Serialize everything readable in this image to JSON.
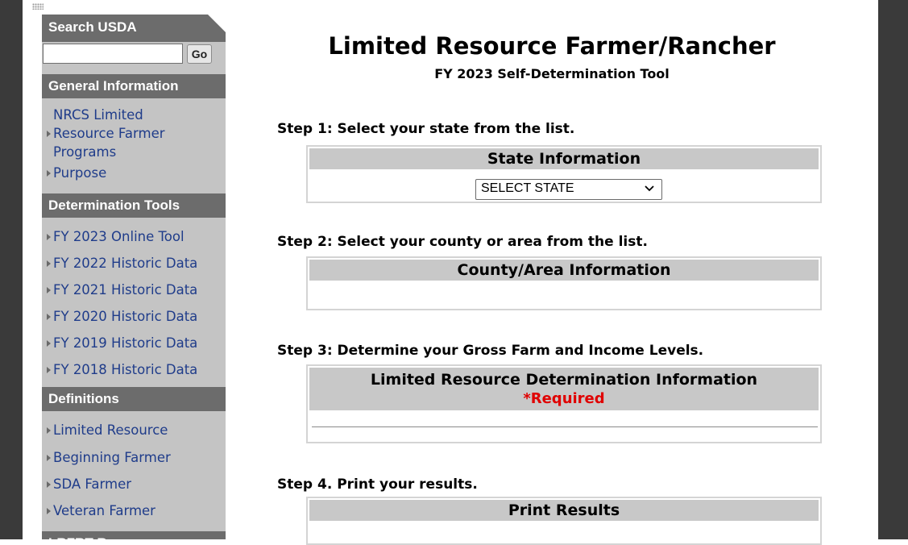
{
  "sidebar": {
    "search_title": "Search USDA",
    "go_label": "Go",
    "sections": {
      "general": "General Information",
      "tools": "Determination Tools",
      "definitions": "Definitions",
      "resources": "LRFRT Resources"
    },
    "general_items": [
      "NRCS Limited\nResource Farmer\nPrograms",
      "Purpose"
    ],
    "tool_items": [
      "FY 2023 Online Tool",
      "FY 2022 Historic Data",
      "FY 2021 Historic Data",
      "FY 2020 Historic Data",
      "FY 2019 Historic Data",
      "FY 2018 Historic Data"
    ],
    "definition_items": [
      "Limited Resource",
      "Beginning Farmer",
      "SDA Farmer",
      "Veteran Farmer"
    ]
  },
  "main": {
    "title": "Limited Resource Farmer/Rancher",
    "subtitle": "FY 2023 Self-Determination Tool",
    "step1": "Step 1: Select your state from the list.",
    "state_panel": "State Information",
    "state_select": "SELECT STATE",
    "step2": "Step 2: Select your county or area from the list.",
    "county_panel": "County/Area Information",
    "step3": "Step 3: Determine your Gross Farm and Income Levels.",
    "lr_panel": "Limited Resource Determination Information",
    "required": "*Required",
    "step4": "Step 4. Print your results.",
    "print_panel": "Print Results"
  },
  "colors": {
    "link": "#1f3c8a",
    "section_bg": "#6c6c6c",
    "sidebar_bg": "#c4c4c4",
    "required": "#e00000"
  }
}
